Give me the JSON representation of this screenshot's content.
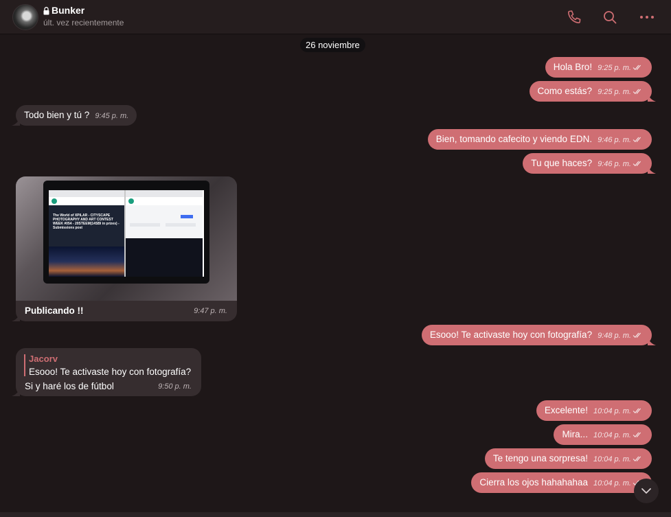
{
  "header": {
    "title": "Bunker",
    "status": "últ. vez recientemente",
    "icons": [
      "lock-icon",
      "phone-icon",
      "search-icon",
      "more-icon"
    ],
    "accent_color": "#cf6e73"
  },
  "date_separator": "26 noviembre",
  "messages": [
    {
      "id": "m1",
      "dir": "out",
      "text": "Hola Bro!",
      "time": "9:25 p. m."
    },
    {
      "id": "m2",
      "dir": "out",
      "text": "Como estás?",
      "time": "9:25 p. m."
    },
    {
      "id": "m3",
      "dir": "in",
      "text": "Todo bien y tú ?",
      "time": "9:45 p. m."
    },
    {
      "id": "m4",
      "dir": "out",
      "text": "Bien, tomando cafecito y viendo EDN.",
      "time": "9:46 p. m."
    },
    {
      "id": "m5",
      "dir": "out",
      "text": "Tu que haces?",
      "time": "9:46 p. m."
    },
    {
      "id": "m6",
      "dir": "in",
      "type": "photo",
      "caption": "Publicando !!",
      "time": "9:47 p. m.",
      "photo_text": "The World of XPILAR - CITYSCAPE PHOTOGRAPHY AND ART CONTEST WEEK #054 - 20STEEM(14SBI in prizes) - Submissions post"
    },
    {
      "id": "m7",
      "dir": "out",
      "text": "Esooo! Te activaste hoy con fotografía?",
      "time": "9:48 p. m."
    },
    {
      "id": "m8",
      "dir": "in",
      "type": "reply",
      "reply_author": "Jacorv",
      "reply_quote": "Esooo! Te activaste hoy con fotografía?",
      "text": "Si y haré los de fútbol",
      "time": "9:50 p. m."
    },
    {
      "id": "m9",
      "dir": "out",
      "text": "Excelente!",
      "time": "10:04 p. m."
    },
    {
      "id": "m10",
      "dir": "out",
      "text": "Mira...",
      "time": "10:04 p. m."
    },
    {
      "id": "m11",
      "dir": "out",
      "text": "Te tengo una sorpresa!",
      "time": "10:04 p. m."
    },
    {
      "id": "m12",
      "dir": "out",
      "text": "Cierra los ojos hahahahaa",
      "time": "10:04 p. m."
    }
  ],
  "colors": {
    "background": "#1e1718",
    "outgoing_bubble": "#cf6e73",
    "incoming_bubble": "#362d2f"
  }
}
